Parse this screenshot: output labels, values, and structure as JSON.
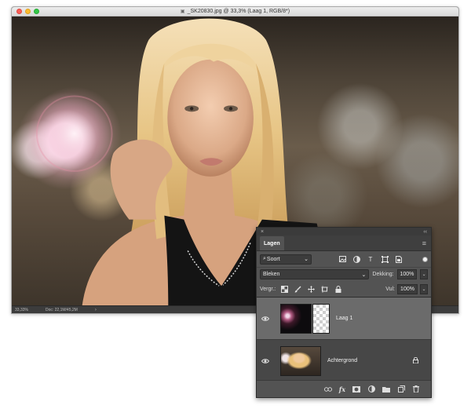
{
  "document": {
    "title": "_SK20830.jpg @ 33,3% (Laag 1, RGB/8*)",
    "zoom": "33,33%",
    "doc_info": "Doc: 22,1M/45,2M"
  },
  "layers_panel": {
    "tab_label": "Lagen",
    "filter_kind": "Soort",
    "blend_mode": "Bleken",
    "opacity_label": "Dekking:",
    "opacity_value": "100%",
    "lock_label": "Vergr.:",
    "fill_label": "Vul:",
    "fill_value": "100%",
    "layers": [
      {
        "name": "Laag 1",
        "visible": true,
        "selected": true
      },
      {
        "name": "Achtergrond",
        "visible": true,
        "locked": true
      }
    ]
  },
  "colors": {
    "panel_bg": "#535353",
    "selected_layer": "#6b6b6b",
    "window_chrome": "#3a3a3a"
  }
}
